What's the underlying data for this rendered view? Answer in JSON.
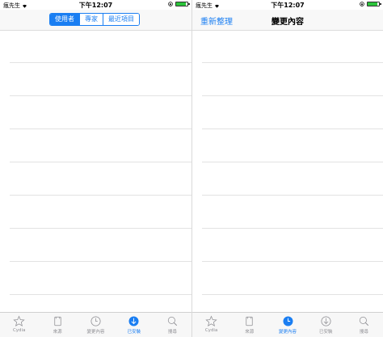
{
  "status": {
    "carrier": "瘋先生",
    "time": "下午12:07"
  },
  "left_screen": {
    "segments": [
      {
        "label": "使用者",
        "active": true
      },
      {
        "label": "專家",
        "active": false
      },
      {
        "label": "最近項目",
        "active": false
      }
    ],
    "active_tab": "已安裝"
  },
  "right_screen": {
    "nav_left_button": "重新整理",
    "title": "變更內容",
    "active_tab": "變更內容"
  },
  "tabs": [
    {
      "label": "Cydia",
      "icon": "star-icon"
    },
    {
      "label": "來源",
      "icon": "sources-icon"
    },
    {
      "label": "變更內容",
      "icon": "clock-icon"
    },
    {
      "label": "已安裝",
      "icon": "download-icon"
    },
    {
      "label": "搜尋",
      "icon": "search-icon"
    }
  ],
  "colors": {
    "accent": "#1a7ef2",
    "inactive": "#8e8e93",
    "battery": "#2bc43b"
  }
}
